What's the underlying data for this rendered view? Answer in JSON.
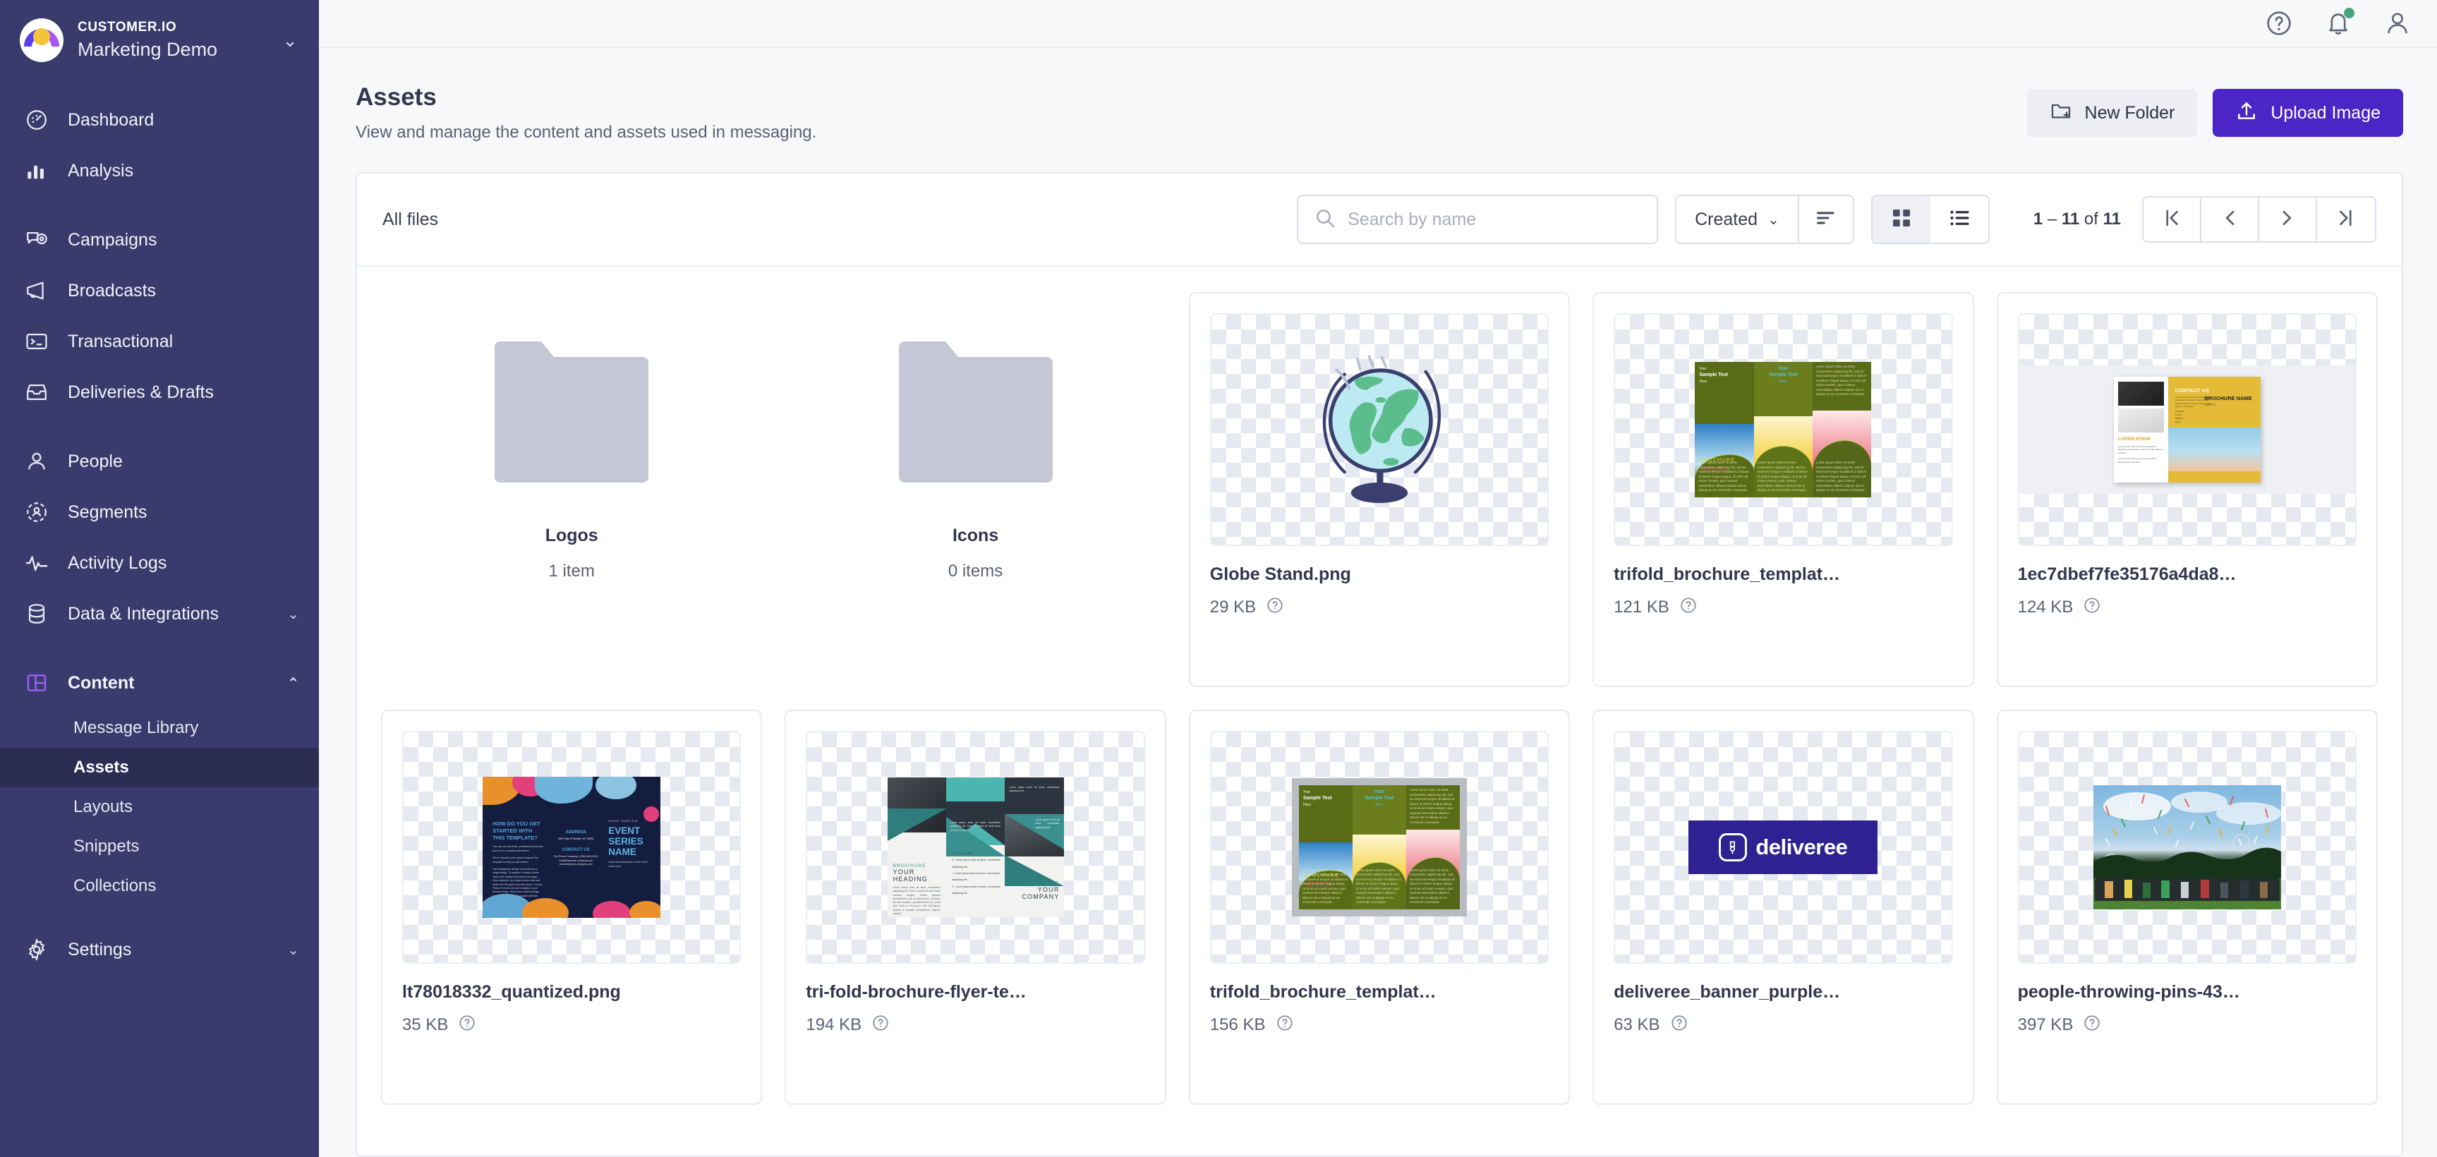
{
  "brand": {
    "org": "CUSTOMER.IO",
    "workspace": "Marketing Demo"
  },
  "topbar": {
    "help": "help-icon",
    "notifications": "bell-icon",
    "account": "user-icon"
  },
  "sidebar": {
    "groups": [
      {
        "items": [
          {
            "label": "Dashboard",
            "icon": "dashboard-icon"
          },
          {
            "label": "Analysis",
            "icon": "bar-chart-icon"
          }
        ]
      },
      {
        "items": [
          {
            "label": "Campaigns",
            "icon": "campaign-icon"
          },
          {
            "label": "Broadcasts",
            "icon": "megaphone-icon"
          },
          {
            "label": "Transactional",
            "icon": "terminal-icon"
          },
          {
            "label": "Deliveries & Drafts",
            "icon": "inbox-icon"
          }
        ]
      },
      {
        "items": [
          {
            "label": "People",
            "icon": "person-icon"
          },
          {
            "label": "Segments",
            "icon": "segment-icon"
          },
          {
            "label": "Activity Logs",
            "icon": "pulse-icon"
          },
          {
            "label": "Data & Integrations",
            "icon": "database-icon",
            "chevron": "chevron-down"
          }
        ]
      },
      {
        "items": [
          {
            "label": "Content",
            "icon": "layout-icon",
            "chevron": "chevron-up",
            "expanded": true
          }
        ],
        "sub": [
          {
            "label": "Message Library",
            "selected": false
          },
          {
            "label": "Assets",
            "selected": true
          },
          {
            "label": "Layouts",
            "selected": false
          },
          {
            "label": "Snippets",
            "selected": false
          },
          {
            "label": "Collections",
            "selected": false
          }
        ]
      },
      {
        "items": [
          {
            "label": "Settings",
            "icon": "gear-icon",
            "chevron": "chevron-down"
          }
        ]
      }
    ]
  },
  "page": {
    "title": "Assets",
    "description": "View and manage the content and assets used in messaging.",
    "new_folder_label": "New Folder",
    "upload_label": "Upload Image"
  },
  "toolbar": {
    "all_files": "All files",
    "search_placeholder": "Search by name",
    "search_value": "",
    "sort_field": "Created",
    "view_mode": "grid"
  },
  "pagination": {
    "range_start": "1",
    "range_end": "11",
    "total": "11",
    "label": "1 – 11 of 11",
    "first": "|<",
    "prev": "<",
    "next": ">",
    "last": ">|"
  },
  "folders": [
    {
      "name": "Logos",
      "count": "1 item"
    },
    {
      "name": "Icons",
      "count": "0 items"
    }
  ],
  "files": [
    {
      "name": "Globe Stand.png",
      "size": "29 KB",
      "art": "globe"
    },
    {
      "name": "trifold_brochure_templat…",
      "size": "121 KB",
      "art": "green-brochure"
    },
    {
      "name": "1ec7dbef7fe35176a4da8…",
      "size": "124 KB",
      "art": "yellow-brochure"
    },
    {
      "name": "lt78018332_quantized.png",
      "size": "35 KB",
      "art": "event-brochure"
    },
    {
      "name": "tri-fold-brochure-flyer-te…",
      "size": "194 KB",
      "art": "teal-brochure"
    },
    {
      "name": "trifold_brochure_templat…",
      "size": "156 KB",
      "art": "green-brochure-framed"
    },
    {
      "name": "deliveree_banner_purple…",
      "size": "63 KB",
      "art": "deliveree-banner"
    },
    {
      "name": "people-throwing-pins-43…",
      "size": "397 KB",
      "art": "crowd-photo"
    }
  ],
  "artwork": {
    "green_brochure": {
      "title_small": "Your",
      "title_big": "Sample Text",
      "title_end": "Here",
      "brochure_word": "BROCHURE",
      "design_word": "DESIGN",
      "lorem": "Lorem ipsum dolor sit amet, consectetur adipiscing elit, sed do eiusmod tempor incididunt ut labore et dolore magna aliqua. Ut enim ad minim veniam, quis nostrud exercitation ullamco laboris nisi ut aliquip ex ea commodo consequat."
    },
    "yellow_brochure": {
      "contact": "CONTACT US",
      "brochure_name": "BROCHURE NAME",
      "subtitle": "SUBTITLE",
      "lorem_label": "LOREM IPSUM"
    },
    "event_brochure": {
      "heading": "HOW DO YOU GET STARTED WITH THIS TEMPLATE?",
      "body1": "You can use this fresh, professional brochure just as it is or easily customize it.",
      "body2": "We've included a few tips throughout the template to help you get started.",
      "body3": "The background design is included as a single image. To replace it, simply double click in the header and select the image. Once selected, do a right mouse-click and select the Fill option from the menu. Choose Picture from the list and navigate to your desired image. Select your desired image and the background will update just that easily.",
      "address_label": "ADDRESS",
      "address": "4567 Main St Buffalo, NY 98052",
      "contact_label": "CONTACT US",
      "contact": "The Phone Company | (206) 555-0100 | info@thephone-company.com www.thephone-company.com",
      "event_subtitle": "EVENT SUBTITLE",
      "event_title": "EVENT SERIES NAME",
      "event_desc": "Add a brief description of the event series here"
    },
    "teal_brochure": {
      "head_small": "BROCHURE",
      "head_big": "YOUR HEADING",
      "head_small2": "BROCHURE",
      "head_big2": "YOUR COMPANY",
      "phone": "00 123 45 6658",
      "lorem": "Lorem ipsum dolor sit amet, consectetur adipiscing elit. Duis in mauris sit amet lacus posuere congue. Donec aliquam condimentum erat ac elementum. Curabitur vel felis tincidunt, convallis lectus nec, porta nibh. Proin ac nisl purus. Sed velit ipsum, facilisis ut volutpat condimentum, aliquam suscipit.",
      "lorem_short": "Lorem ipsum dolor sit amet, consectetur adipiscing elit."
    },
    "deliveree": {
      "word": "deliveree"
    }
  },
  "colors": {
    "sidebar_bg": "#383b6b",
    "sidebar_active": "#2b2e52",
    "accent_purple": "#4c25c6",
    "content_icon": "#9b5cf6",
    "page_bg": "#f7f8fa",
    "text_dark": "#33364d",
    "text_muted": "#5d6173",
    "notification_dot": "#49a47c"
  }
}
